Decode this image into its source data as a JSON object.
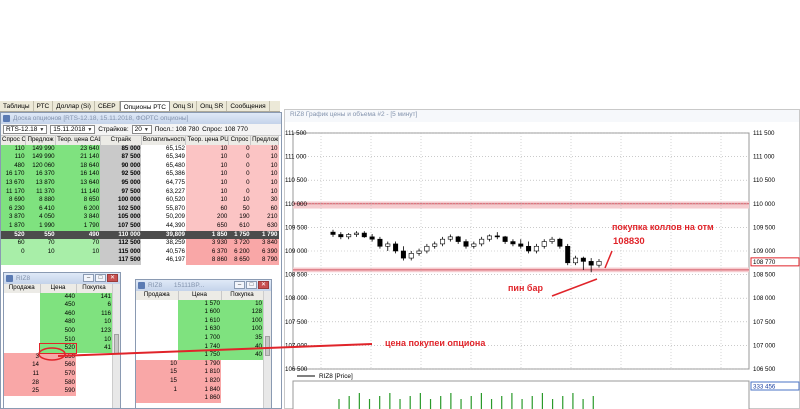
{
  "tabs": [
    "Таблицы",
    "РТС",
    "Доллар (Si)",
    "СБЕР",
    "Опционы РТС",
    "Опц SI",
    "Опц SR",
    "Сообщения"
  ],
  "active_tab_index": 4,
  "options_window": {
    "title": "Доска опционов [RTS-12.18, 15.11.2018, ФОРТС опционы]",
    "instrument": "RTS-12.18",
    "date": "15.11.2018",
    "strikes_label": "Страйков:",
    "strikes_value": "20",
    "last_label": "Посл.: 108 780",
    "ask_label": "Спрос: 108 770",
    "headers": [
      "Спрос CAL",
      "Предлож",
      "Теор. цена CAL",
      "Страйк",
      "Волатильность",
      "Теор. цена PUT",
      "Спрос",
      "Предлож"
    ],
    "rows": [
      [
        "110",
        "149 990",
        "23 640",
        "85 000",
        "65,152",
        "10",
        "0",
        "10"
      ],
      [
        "110",
        "149 990",
        "21 140",
        "87 500",
        "65,349",
        "10",
        "0",
        "10"
      ],
      [
        "480",
        "120 060",
        "18 640",
        "90 000",
        "65,480",
        "10",
        "0",
        "10"
      ],
      [
        "16 170",
        "16 370",
        "16 140",
        "92 500",
        "65,386",
        "10",
        "0",
        "10"
      ],
      [
        "13 670",
        "13 870",
        "13 640",
        "95 000",
        "64,775",
        "10",
        "0",
        "10"
      ],
      [
        "11 170",
        "11 370",
        "11 140",
        "97 500",
        "63,227",
        "10",
        "0",
        "10"
      ],
      [
        "8 690",
        "8 880",
        "8 650",
        "100 000",
        "60,520",
        "10",
        "10",
        "30"
      ],
      [
        "6 230",
        "6 410",
        "6 200",
        "102 500",
        "55,870",
        "60",
        "50",
        "60"
      ],
      [
        "3 870",
        "4 050",
        "3 840",
        "105 000",
        "50,209",
        "200",
        "190",
        "210"
      ],
      [
        "1 870",
        "1 990",
        "1 790",
        "107 500",
        "44,390",
        "650",
        "610",
        "630"
      ],
      [
        "520",
        "550",
        "490",
        "110 000",
        "39,809",
        "1 850",
        "1 750",
        "1 790"
      ],
      [
        "60",
        "70",
        "70",
        "112 500",
        "38,259",
        "3 930",
        "3 720",
        "3 840"
      ],
      [
        "0",
        "10",
        "10",
        "115 000",
        "40,576",
        "6 370",
        "6 200",
        "6 390"
      ],
      [
        "",
        "",
        "",
        "117 500",
        "46,197",
        "8 860",
        "8 650",
        "8 790"
      ]
    ]
  },
  "riz_window": {
    "title": "RIZ8",
    "headers": [
      "Продажа",
      "Цена",
      "Покупка"
    ],
    "rows": [
      [
        "",
        "440",
        "141"
      ],
      [
        "",
        "450",
        "6"
      ],
      [
        "",
        "460",
        "116"
      ],
      [
        "",
        "480",
        "10"
      ],
      [
        "",
        "500",
        "123"
      ],
      [
        "",
        "510",
        "10"
      ],
      [
        "",
        "520",
        "41"
      ],
      [
        "3",
        "550",
        ""
      ],
      [
        "14",
        "560",
        ""
      ],
      [
        "11",
        "570",
        ""
      ],
      [
        "28",
        "580",
        ""
      ],
      [
        "25",
        "590",
        ""
      ]
    ]
  },
  "riz2_window": {
    "title": "RIZ8",
    "title_extra": "15111BP...",
    "headers": [
      "Продажа",
      "Цена",
      "Покупка"
    ],
    "rows": [
      [
        "",
        "1 570",
        "10"
      ],
      [
        "",
        "1 600",
        "128"
      ],
      [
        "",
        "1 610",
        "100"
      ],
      [
        "",
        "1 630",
        "100"
      ],
      [
        "",
        "1 700",
        "35"
      ],
      [
        "",
        "1 740",
        "40"
      ],
      [
        "",
        "1 750",
        "40"
      ],
      [
        "10",
        "1 790",
        ""
      ],
      [
        "15",
        "1 810",
        ""
      ],
      [
        "15",
        "1 820",
        ""
      ],
      [
        "1",
        "1 840",
        ""
      ],
      [
        "",
        "1 860",
        ""
      ]
    ]
  },
  "chart": {
    "title": "RIZ8 График цены и объема #2 - [5 минут]",
    "price_tag": "108 770",
    "legend": "RIZ8 [Price]",
    "volume_tag": "333 456",
    "annotations": {
      "buy_calls": "покупка коллов на отм",
      "level": "108830",
      "pin_bar": "пин бар",
      "option_price": "цена покупеи опциона"
    },
    "colors": {
      "candle": "#000000",
      "zone": "#f6cccf",
      "annot": "#e0242a",
      "price_tag_border": "#e0242a"
    }
  },
  "chart_data": {
    "type": "candlestick",
    "ylim": [
      106500,
      111500
    ],
    "y_ticks": [
      "111 500",
      "111 000",
      "110 500",
      "110 000",
      "109 500",
      "109 000",
      "108 500",
      "108 000",
      "107 500",
      "107 000",
      "106 500"
    ],
    "y_tick_values": [
      111500,
      111000,
      110500,
      110000,
      109500,
      109000,
      108500,
      108000,
      107500,
      107000,
      106500
    ],
    "candles": [
      [
        109400,
        109450,
        109300,
        109350
      ],
      [
        109350,
        109400,
        109250,
        109300
      ],
      [
        109300,
        109380,
        109250,
        109350
      ],
      [
        109350,
        109420,
        109300,
        109380
      ],
      [
        109380,
        109420,
        109280,
        109300
      ],
      [
        109300,
        109360,
        109200,
        109250
      ],
      [
        109250,
        109300,
        109050,
        109100
      ],
      [
        109100,
        109200,
        109000,
        109150
      ],
      [
        109150,
        109200,
        108950,
        109000
      ],
      [
        109000,
        109100,
        108800,
        108850
      ],
      [
        108850,
        109000,
        108800,
        108950
      ],
      [
        108950,
        109050,
        108900,
        109000
      ],
      [
        109000,
        109150,
        108950,
        109100
      ],
      [
        109100,
        109200,
        109050,
        109150
      ],
      [
        109150,
        109300,
        109100,
        109250
      ],
      [
        109250,
        109350,
        109200,
        109300
      ],
      [
        109300,
        109320,
        109150,
        109200
      ],
      [
        109200,
        109250,
        109050,
        109100
      ],
      [
        109100,
        109200,
        109050,
        109150
      ],
      [
        109150,
        109300,
        109100,
        109250
      ],
      [
        109250,
        109350,
        109200,
        109320
      ],
      [
        109320,
        109400,
        109250,
        109300
      ],
      [
        109300,
        109320,
        109150,
        109200
      ],
      [
        109200,
        109250,
        109100,
        109150
      ],
      [
        109150,
        109250,
        109050,
        109100
      ],
      [
        109100,
        109200,
        108950,
        109000
      ],
      [
        109000,
        109150,
        108950,
        109100
      ],
      [
        109100,
        109250,
        109050,
        109200
      ],
      [
        109200,
        109300,
        109150,
        109250
      ],
      [
        109250,
        109280,
        109050,
        109100
      ],
      [
        109100,
        109150,
        108700,
        108750
      ],
      [
        108750,
        108900,
        108700,
        108850
      ],
      [
        108850,
        108880,
        108600,
        108780
      ],
      [
        108780,
        108850,
        108550,
        108700
      ],
      [
        108700,
        108830,
        108650,
        108780
      ]
    ],
    "zones": [
      [
        109900,
        110050
      ],
      [
        108550,
        108650
      ]
    ],
    "hlines": [
      110000,
      108600
    ]
  }
}
